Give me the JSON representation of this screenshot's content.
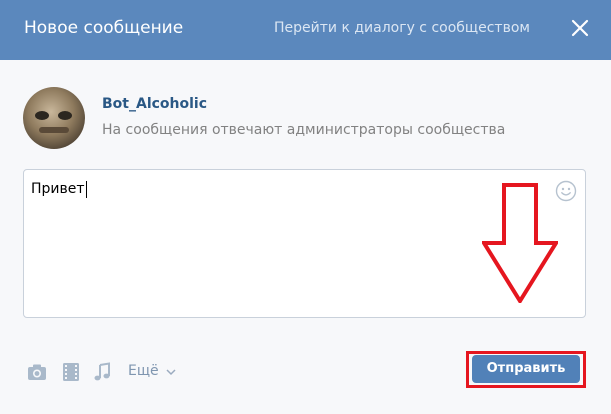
{
  "header": {
    "title": "Новое сообщение",
    "go_dialog_link": "Перейти к диалогу с сообществом",
    "close_icon": "close-icon"
  },
  "sender": {
    "name": "Bot_Alcoholic",
    "subtitle": "На сообщения отвечают администраторы сообщества"
  },
  "message": {
    "value": "Привет",
    "emoji_icon": "smile-icon"
  },
  "toolbar": {
    "icons": [
      "camera-icon",
      "video-icon",
      "music-icon"
    ],
    "more_label": "Ещё"
  },
  "send": {
    "label": "Отправить"
  },
  "annotation": {
    "arrow_color": "#e5161f",
    "highlight_color": "#e5161f"
  },
  "colors": {
    "header_bg": "#5b88bd",
    "link": "#2a5885",
    "button": "#5181b8"
  }
}
